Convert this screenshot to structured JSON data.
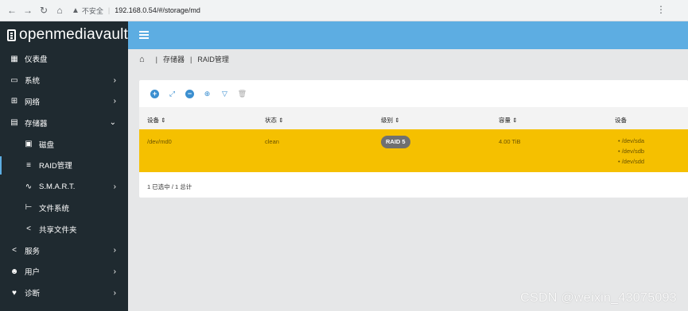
{
  "browser": {
    "insecure_label": "不安全",
    "url": "192.168.0.54/#/storage/md"
  },
  "brand": {
    "name": "openmediavault"
  },
  "sidebar": {
    "items": [
      {
        "label": "仪表盘",
        "icon": "dashboard-icon"
      },
      {
        "label": "系统",
        "icon": "laptop-icon"
      },
      {
        "label": "网络",
        "icon": "network-icon"
      },
      {
        "label": "存储器",
        "icon": "storage-icon"
      },
      {
        "label": "磁盘",
        "icon": "disk-icon"
      },
      {
        "label": "RAID管理",
        "icon": "database-icon"
      },
      {
        "label": "S.M.A.R.T.",
        "icon": "pulse-icon"
      },
      {
        "label": "文件系统",
        "icon": "tree-icon"
      },
      {
        "label": "共享文件夹",
        "icon": "share-icon"
      },
      {
        "label": "服务",
        "icon": "share-icon"
      },
      {
        "label": "用户",
        "icon": "users-icon"
      },
      {
        "label": "诊断",
        "icon": "heartbeat-icon"
      }
    ]
  },
  "breadcrumb": {
    "items": [
      "存储器",
      "RAID管理"
    ]
  },
  "table": {
    "columns": [
      "设备",
      "状态",
      "级别",
      "容量",
      "设备"
    ],
    "rows": [
      {
        "device": "/dev/md0",
        "state": "clean",
        "level": "RAID 5",
        "capacity": "4.00 TiB",
        "devices": [
          "/dev/sda",
          "/dev/sdb",
          "/dev/sdd"
        ]
      }
    ],
    "footer": "1 已选中 / 1 总计"
  },
  "watermark": "CSDN @weixin_43075093",
  "colors": {
    "accent": "#5dade2",
    "sidebar": "#1f2a30",
    "selected_row": "#f5c000"
  }
}
